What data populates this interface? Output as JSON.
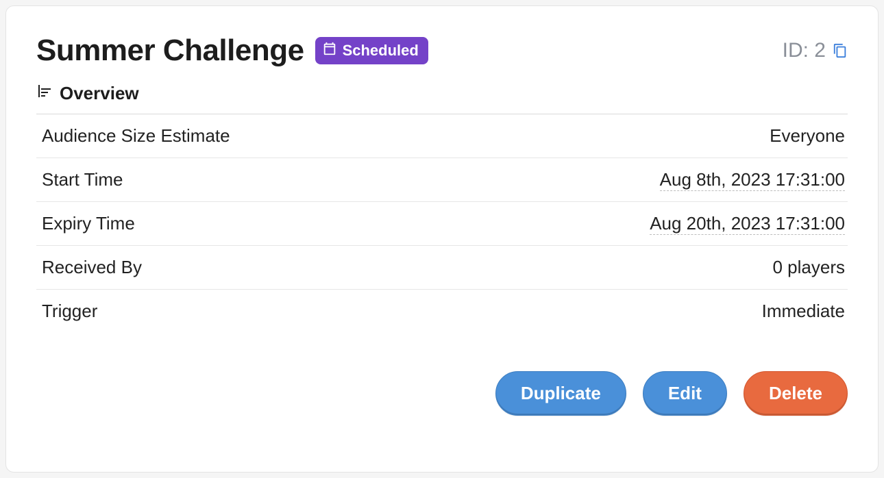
{
  "header": {
    "title": "Summer Challenge",
    "status_label": "Scheduled",
    "id_label": "ID: 2"
  },
  "overview": {
    "section_label": "Overview",
    "rows": [
      {
        "label": "Audience Size Estimate",
        "value": "Everyone",
        "dotted": false
      },
      {
        "label": "Start Time",
        "value": "Aug 8th, 2023 17:31:00",
        "dotted": true
      },
      {
        "label": "Expiry Time",
        "value": "Aug 20th, 2023 17:31:00",
        "dotted": true
      },
      {
        "label": "Received By",
        "value": "0 players",
        "dotted": false
      },
      {
        "label": "Trigger",
        "value": "Immediate",
        "dotted": false
      }
    ]
  },
  "actions": {
    "duplicate": "Duplicate",
    "edit": "Edit",
    "delete": "Delete"
  }
}
